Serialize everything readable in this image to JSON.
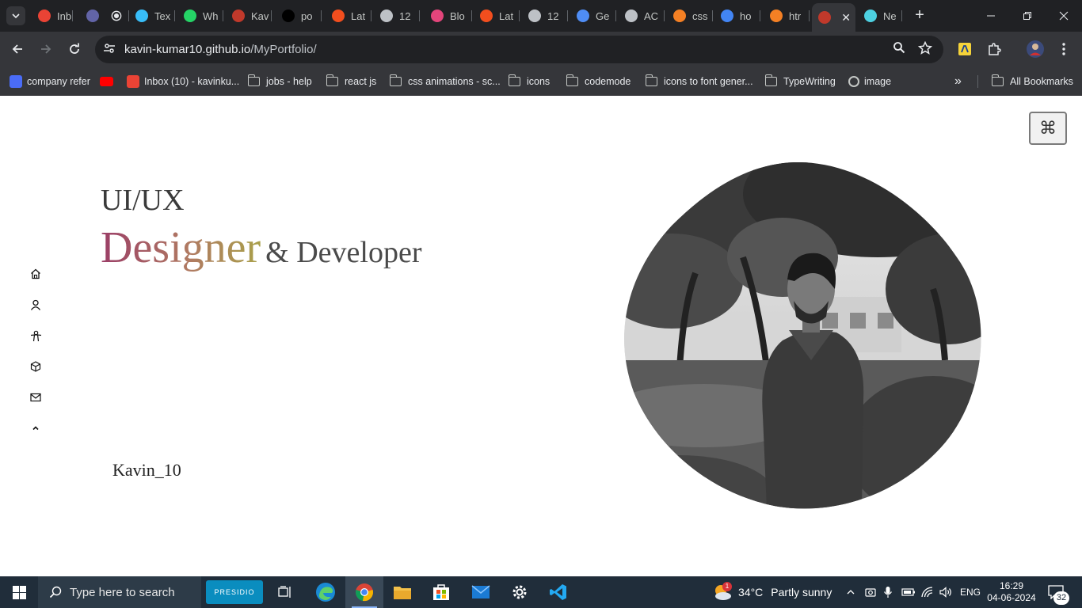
{
  "browser": {
    "tabs": [
      {
        "label": "Inb",
        "icon": "gmail-icon",
        "color": "#ea4335"
      },
      {
        "label": "",
        "icon": "teams-icon",
        "color": "#6264a7"
      },
      {
        "label": "",
        "icon": "record-icon",
        "color": "#e8eaed"
      },
      {
        "label": "Tex",
        "icon": "tailwind-icon",
        "color": "#38bdf8"
      },
      {
        "label": "Wh",
        "icon": "whatsapp-icon",
        "color": "#25d366"
      },
      {
        "label": "Kav",
        "icon": "portfolio-icon",
        "color": "#c0392b"
      },
      {
        "label": "po",
        "icon": "s-icon",
        "color": "#000000"
      },
      {
        "label": "Lat",
        "icon": "figma-icon",
        "color": "#f24e1e"
      },
      {
        "label": "12",
        "icon": "globe-icon",
        "color": "#bdc1c6"
      },
      {
        "label": "Blo",
        "icon": "blogger-icon",
        "color": "#e3457b"
      },
      {
        "label": "Lat",
        "icon": "figma-icon",
        "color": "#f24e1e"
      },
      {
        "label": "12",
        "icon": "globe-icon",
        "color": "#bdc1c6"
      },
      {
        "label": "Ge",
        "icon": "gemini-icon",
        "color": "#4f8df5"
      },
      {
        "label": "AC",
        "icon": "globe-icon",
        "color": "#bdc1c6"
      },
      {
        "label": "css",
        "icon": "stackoverflow-icon",
        "color": "#f48024"
      },
      {
        "label": "ho",
        "icon": "google-icon",
        "color": "#4285f4"
      },
      {
        "label": "htr",
        "icon": "stackoverflow-icon",
        "color": "#f48024"
      },
      {
        "label": "",
        "icon": "portfolio-icon",
        "color": "#c0392b",
        "active": true
      },
      {
        "label": "Ne",
        "icon": "m-icon",
        "color": "#4dd0e1"
      }
    ],
    "close_glyph": "✕",
    "new_tab_glyph": "+",
    "address_host": "kavin-kumar10.github.io",
    "address_path": "/MyPortfolio/",
    "bookmarks": [
      {
        "label": "company refer",
        "icon": "cube-icon",
        "color": "#4a6cf7"
      },
      {
        "label": "",
        "icon": "youtube-icon",
        "color": "#ff0000"
      },
      {
        "label": "Inbox (10) - kavinku...",
        "icon": "gmail-icon",
        "color": "#ea4335"
      },
      {
        "label": "jobs - help",
        "icon": "folder-icon"
      },
      {
        "label": "react js",
        "icon": "folder-icon"
      },
      {
        "label": "css animations - sc...",
        "icon": "folder-icon"
      },
      {
        "label": "icons",
        "icon": "folder-icon"
      },
      {
        "label": "codemode",
        "icon": "folder-icon"
      },
      {
        "label": "icons to font gener...",
        "icon": "folder-icon"
      },
      {
        "label": "TypeWriting",
        "icon": "folder-icon"
      },
      {
        "label": "image",
        "icon": "globe-icon"
      }
    ],
    "overflow_glyph": "»",
    "all_bookmarks": "All Bookmarks"
  },
  "page": {
    "cmd_glyph": "⌘",
    "heading_line1": "UI/UX",
    "heading_highlight": "Designer",
    "heading_rest": "& Developer",
    "handle": "Kavin_10",
    "nav_items": [
      "home-icon",
      "user-icon",
      "skills-icon",
      "projects-icon",
      "mail-icon",
      "scroll-up-icon"
    ]
  },
  "taskbar": {
    "search_placeholder": "Type here to search",
    "presidio_label": "PRESIDIO",
    "weather_badge": "1",
    "weather_temp": "34°C",
    "weather_desc": "Partly sunny",
    "language": "ENG",
    "time": "16:29",
    "date": "04-06-2024",
    "notification_count": "32"
  }
}
